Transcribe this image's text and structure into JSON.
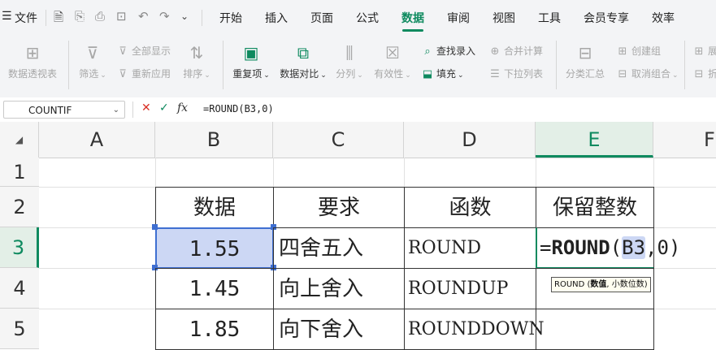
{
  "menu": {
    "file": "文件",
    "tabs": [
      "开始",
      "插入",
      "页面",
      "公式",
      "数据",
      "审阅",
      "视图",
      "工具",
      "会员专享",
      "效率"
    ],
    "active_tab": "数据"
  },
  "ribbon": {
    "pivot": "数据透视表",
    "filter": "筛选",
    "show_all": "全部显示",
    "reapply": "重新应用",
    "sort": "排序",
    "duplicates": "重复项",
    "compare": "数据对比",
    "split": "分列",
    "validity": "有效性",
    "lookup_entry": "查找录入",
    "fill": "填充",
    "merge_calc": "合并计算",
    "dropdown_list": "下拉列表",
    "subtotal": "分类汇总",
    "create_group": "创建组",
    "ungroup": "取消组合",
    "edge_1": "展",
    "edge_2": "折"
  },
  "formula_bar": {
    "name_box": "COUNTIF",
    "fx": "fx",
    "formula": "=ROUND(B3,0)"
  },
  "columns": [
    "A",
    "B",
    "C",
    "D",
    "E",
    "F"
  ],
  "rows": [
    "1",
    "2",
    "3",
    "4",
    "5"
  ],
  "table": {
    "headers": [
      "数据",
      "要求",
      "函数",
      "保留整数"
    ],
    "rows": [
      {
        "value": "1.55",
        "requirement": "四舍五入",
        "function": "ROUND"
      },
      {
        "value": "1.45",
        "requirement": "向上舍入",
        "function": "ROUNDUP"
      },
      {
        "value": "1.85",
        "requirement": "向下舍入",
        "function": "ROUNDDOWN"
      }
    ]
  },
  "editing": {
    "prefix": "=",
    "fn": "ROUND",
    "open": "(",
    "ref": "B3",
    "rest": ",0)"
  },
  "tooltip": {
    "fn": "ROUND",
    "open": " (",
    "arg1": "数值",
    "rest": ", 小数位数)"
  },
  "colors": {
    "accent": "#0e8a5f",
    "selection_fill": "#ccd7f4",
    "selection_border": "#3f6fd1"
  }
}
